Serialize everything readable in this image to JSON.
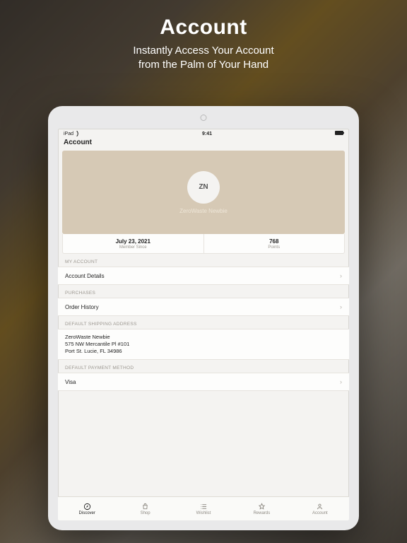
{
  "hero": {
    "title": "Account",
    "subtitle_l1": "Instantly Access Your Account",
    "subtitle_l2": "from the Palm of Your Hand"
  },
  "status": {
    "device": "iPad",
    "time": "9:41"
  },
  "page_title": "Account",
  "profile": {
    "initials": "ZN",
    "name": "ZeroWaste Newbie"
  },
  "stats": {
    "member_since": {
      "value": "July 23, 2021",
      "label": "Member Since"
    },
    "points": {
      "value": "768",
      "label": "Points"
    }
  },
  "sections": {
    "my_account_label": "MY ACCOUNT",
    "account_details": "Account Details",
    "purchases_label": "PURCHASES",
    "order_history": "Order History",
    "shipping_label": "DEFAULT SHIPPING ADDRESS",
    "shipping_addr": {
      "name": "ZeroWaste Newbie",
      "line1": "575 NW Mercantile Pl #101",
      "line2": "Port St. Lucie, FL 34986"
    },
    "payment_label": "DEFAULT PAYMENT METHOD",
    "payment": "Visa"
  },
  "tabs": {
    "discover": "Discover",
    "shop": "Shop",
    "wishlist": "Wishlist",
    "rewards": "Rewards",
    "account": "Account"
  }
}
